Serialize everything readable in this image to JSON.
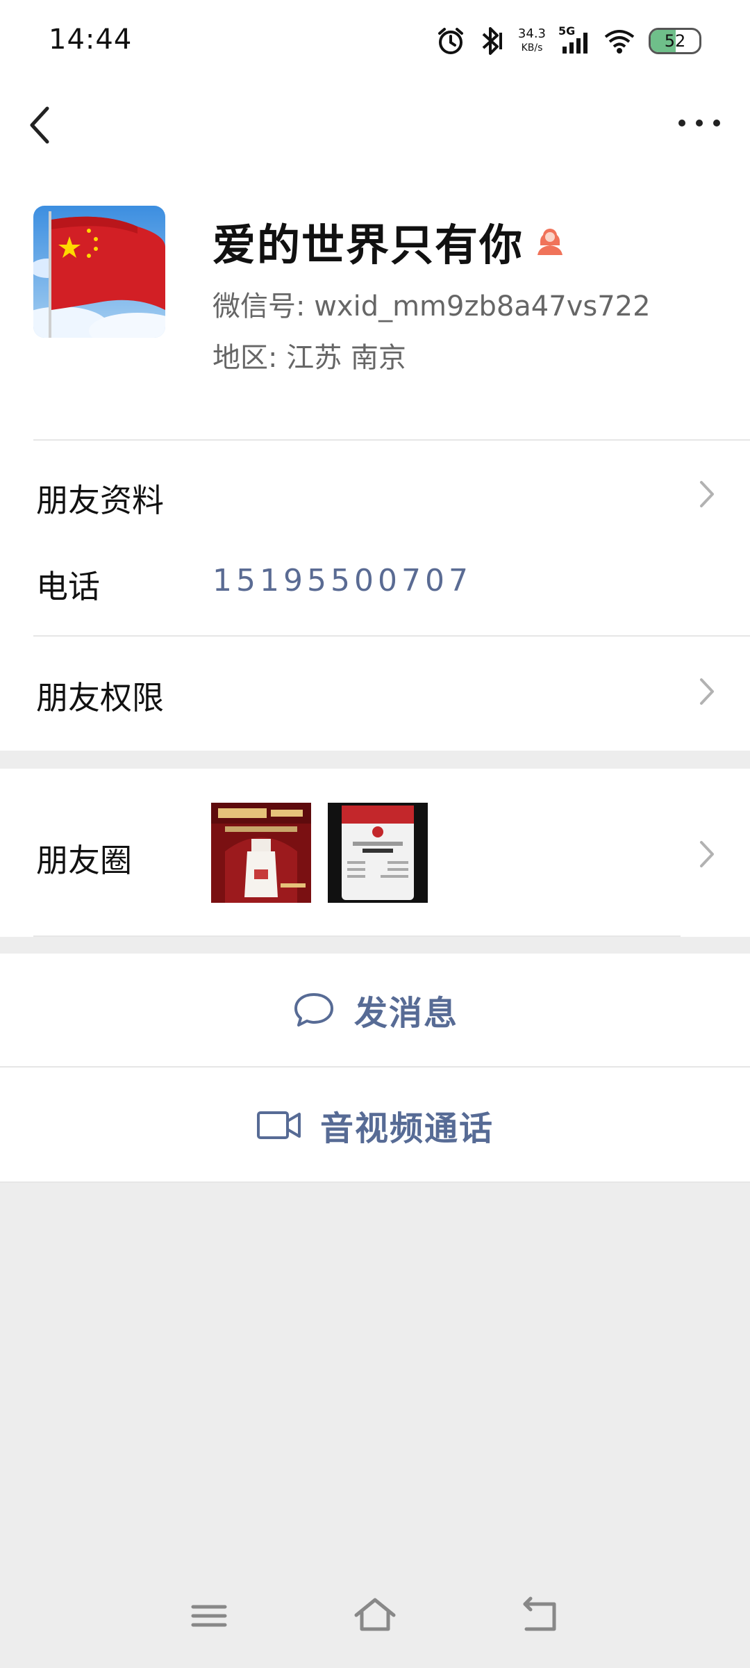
{
  "status_bar": {
    "time": "14:44",
    "net_speed_value": "34.3",
    "net_speed_unit": "KB/s",
    "network": "5G",
    "battery": "52",
    "battery_level": 0.52
  },
  "profile": {
    "nickname": "爱的世界只有你",
    "wechat_id": "微信号: wxid_mm9zb8a47vs722",
    "region": "地区: 江苏 南京"
  },
  "rows": {
    "friend_info": "朋友资料",
    "phone_label": "电话",
    "phone_value": "15195500707",
    "friend_permissions": "朋友权限",
    "moments": "朋友圈"
  },
  "actions": {
    "send_message": "发消息",
    "av_call": "音视频通话"
  },
  "colors": {
    "link": "#576b95",
    "background": "#ededed",
    "gender_female": "#f0735a"
  }
}
